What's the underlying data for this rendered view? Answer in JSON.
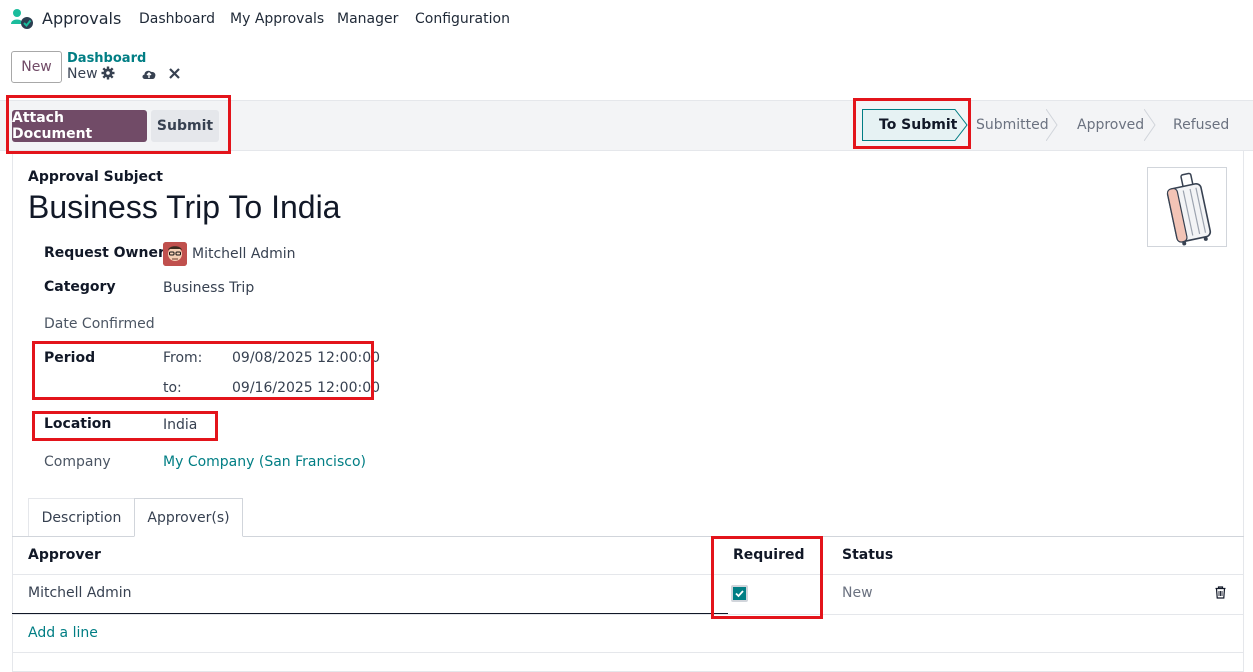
{
  "navbar": {
    "app_name": "Approvals",
    "menus": [
      "Dashboard",
      "My Approvals",
      "Manager",
      "Configuration"
    ]
  },
  "control_panel": {
    "new_button": "New",
    "breadcrumb_parent": "Dashboard",
    "breadcrumb_current": "New"
  },
  "statusbar": {
    "attach_button": "Attach Document",
    "submit_button": "Submit",
    "stages": [
      "To Submit",
      "Submitted",
      "Approved",
      "Refused"
    ],
    "active_stage": "To Submit"
  },
  "form": {
    "subject_label": "Approval Subject",
    "title": "Business Trip To India",
    "fields": {
      "request_owner_label": "Request Owner",
      "request_owner_value": "Mitchell Admin",
      "category_label": "Category",
      "category_value": "Business Trip",
      "date_confirmed_label": "Date Confirmed",
      "period_label": "Period",
      "from_label": "From:",
      "from_value": "09/08/2025 12:00:00",
      "to_label": "to:",
      "to_value": "09/16/2025 12:00:00",
      "location_label": "Location",
      "location_value": "India",
      "company_label": "Company",
      "company_value": "My Company (San Francisco)"
    }
  },
  "tabs": [
    "Description",
    "Approver(s)"
  ],
  "approvers_table": {
    "headers": [
      "Approver",
      "Required",
      "Status"
    ],
    "rows": [
      {
        "approver": "Mitchell Admin",
        "required": true,
        "status": "New"
      }
    ],
    "add_line": "Add a line"
  },
  "colors": {
    "brand": "#714B67",
    "link": "#017e84",
    "highlight": "#e3141b"
  }
}
